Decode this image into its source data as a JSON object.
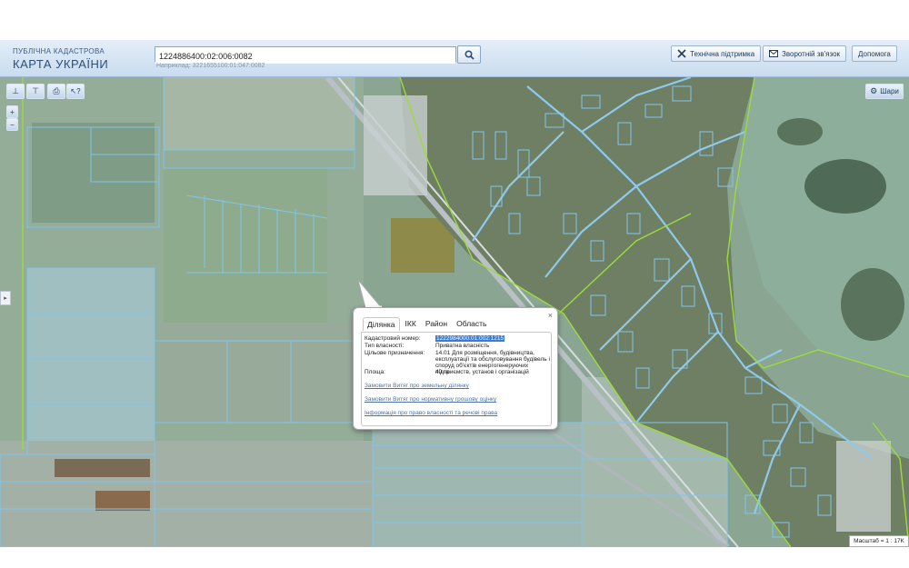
{
  "header": {
    "title_small": "ПУБЛІЧНА КАДАСТРОВА",
    "title_big": "КАРТА УКРАЇНИ"
  },
  "search": {
    "value": "1224886400:02:006:0082",
    "example": "Наприклад: 3221655100:01:047:0082"
  },
  "toolbar": {
    "support_label": "Технічна підтримка",
    "feedback_label": "Зворотній зв'язок",
    "help_label": "Допомога"
  },
  "map_controls": {
    "layers_label": "Шари",
    "zoom_in": "+",
    "zoom_out": "−",
    "side_toggle": "▸"
  },
  "popup": {
    "tabs": [
      "Ділянка",
      "ІКК",
      "Район",
      "Область"
    ],
    "close": "×",
    "fields": {
      "cadastral_label": "Кадастровий номер:",
      "cadastral_value": "1222984000:01:002:1215",
      "ownership_label": "Тип власності:",
      "ownership_value": "Приватна власність",
      "purpose_label": "Цільове призначення:",
      "purpose_value": "14.01 Для розміщення, будівництва, експлуатації та обслуговування будівель і споруд об'єктів енергогенеруючих підприємств, установ і організацій",
      "area_label": "Площа:",
      "area_value": "40 га"
    },
    "links": [
      "Замовити Витяг про земельну ділянку",
      "Замовити Витяг про нормативну грошову оцінку",
      "Інформація про право власності та речові права"
    ]
  },
  "scale": {
    "label": "Масштаб = 1 : 17K"
  },
  "colors": {
    "parcel_outline": "#7fc4ee",
    "boundary_green": "#9bdc3c",
    "header_bg": "#d6e5f3"
  }
}
